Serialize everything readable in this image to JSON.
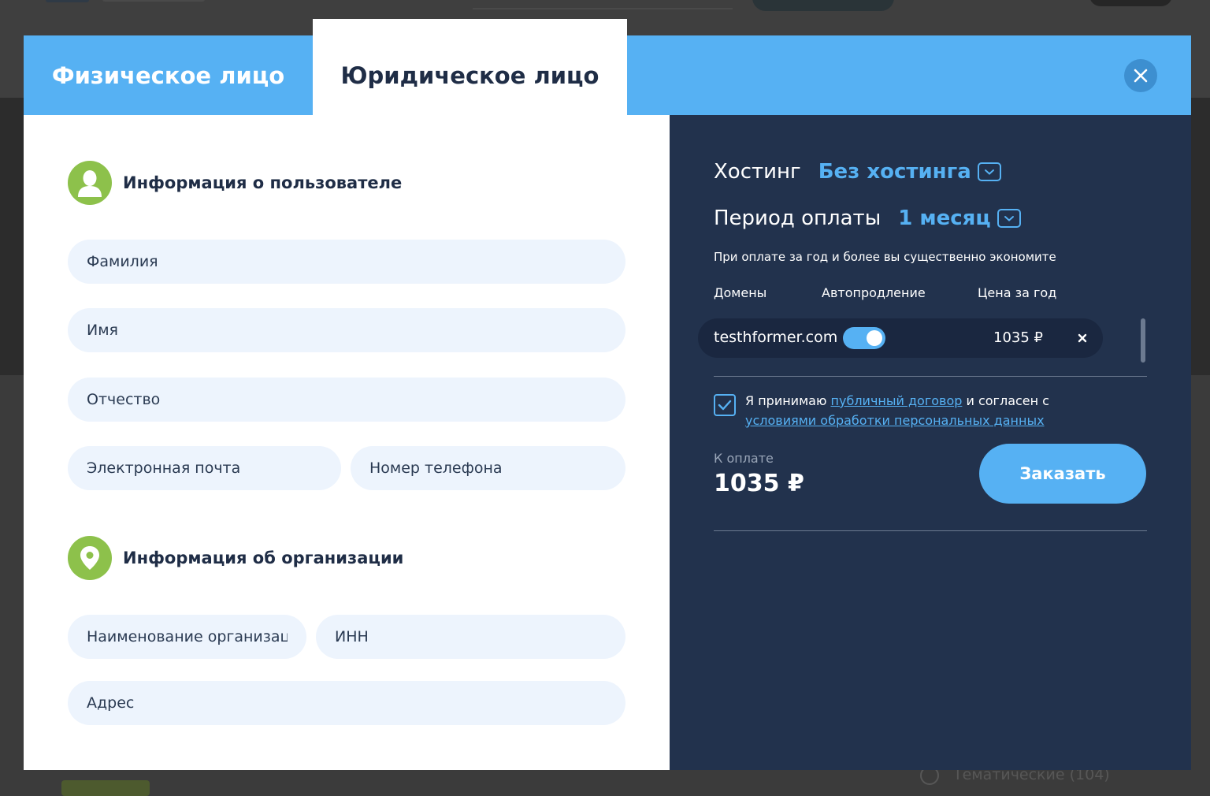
{
  "background": {
    "bottom_text": "Тематические (104)"
  },
  "tabs": {
    "individual": "Физическое лицо",
    "legal": "Юридическое лицо"
  },
  "user_section": {
    "title": "Информация о пользователе",
    "fields": {
      "last_name": "Фамилия",
      "first_name": "Имя",
      "middle_name": "Отчество",
      "email": "Электронная почта",
      "phone": "Номер телефона"
    }
  },
  "org_section": {
    "title": "Информация об организации",
    "fields": {
      "org_name": "Наименование организации",
      "inn": "ИНН",
      "address": "Адрес"
    }
  },
  "order": {
    "hosting_label": "Хостинг",
    "hosting_value": "Без хостинга",
    "period_label": "Период оплаты",
    "period_value": "1 месяц",
    "hint": "При оплате за год и более вы существенно экономите",
    "columns": {
      "domains": "Домены",
      "autorenew": "Автопродление",
      "price": "Цена за год"
    },
    "domain": {
      "name": "testhformer.com",
      "autorenew": true,
      "price": "1035 ₽"
    },
    "agreement": {
      "prefix": "Я принимаю",
      "link1": "публичный договор",
      "middle": "и согласен с",
      "link2": "условиями обработки персональных данных",
      "checked": true
    },
    "pay_label": "К оплате",
    "pay_total": "1035 ₽",
    "order_button": "Заказать"
  },
  "colors": {
    "accent": "#56b1f3",
    "dark_panel": "#22324d",
    "icon_green": "#8dc14b",
    "field_bg": "#edf4fd"
  }
}
